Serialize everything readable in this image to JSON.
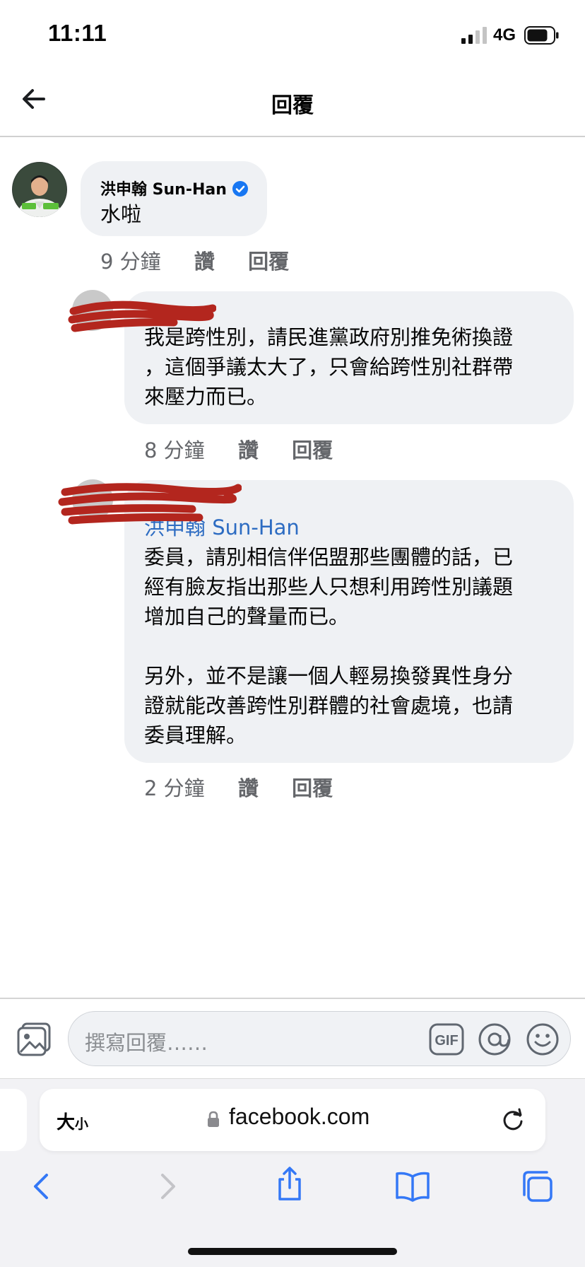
{
  "status_bar": {
    "time": "11:11",
    "network": "4G"
  },
  "header": {
    "title": "回覆"
  },
  "main_comment": {
    "author": "洪申翰 Sun-Han",
    "text": "水啦",
    "time": "9 分鐘",
    "like_label": "讚",
    "reply_label": "回覆"
  },
  "replies": [
    {
      "text_lines": [
        "我是跨性別，請民進黨政府別推免術換證",
        "，這個爭議太大了，只會給跨性別社群帶",
        "來壓力而已。"
      ],
      "time": "8 分鐘",
      "like_label": "讚",
      "reply_label": "回覆"
    },
    {
      "mention": "洪申翰 Sun-Han",
      "text_lines": [
        "委員，請別相信伴侶盟那些團體的話，已",
        "經有臉友指出那些人只想利用跨性別議題",
        "增加自己的聲量而已。",
        "",
        "另外，並不是讓一個人輕易換發異性身分",
        "證就能改善跨性別群體的社會處境，也請",
        "委員理解。"
      ],
      "time": "2 分鐘",
      "like_label": "讚",
      "reply_label": "回覆"
    }
  ],
  "composer": {
    "placeholder": "撰寫回覆……",
    "gif_label": "GIF"
  },
  "browser": {
    "text_size_label": "大",
    "text_size_small": "小",
    "url": "facebook.com"
  },
  "colors": {
    "bubble": "#eff1f4",
    "mention": "#2d6cc2",
    "meta": "#65676b",
    "scribble": "#b3261e"
  }
}
